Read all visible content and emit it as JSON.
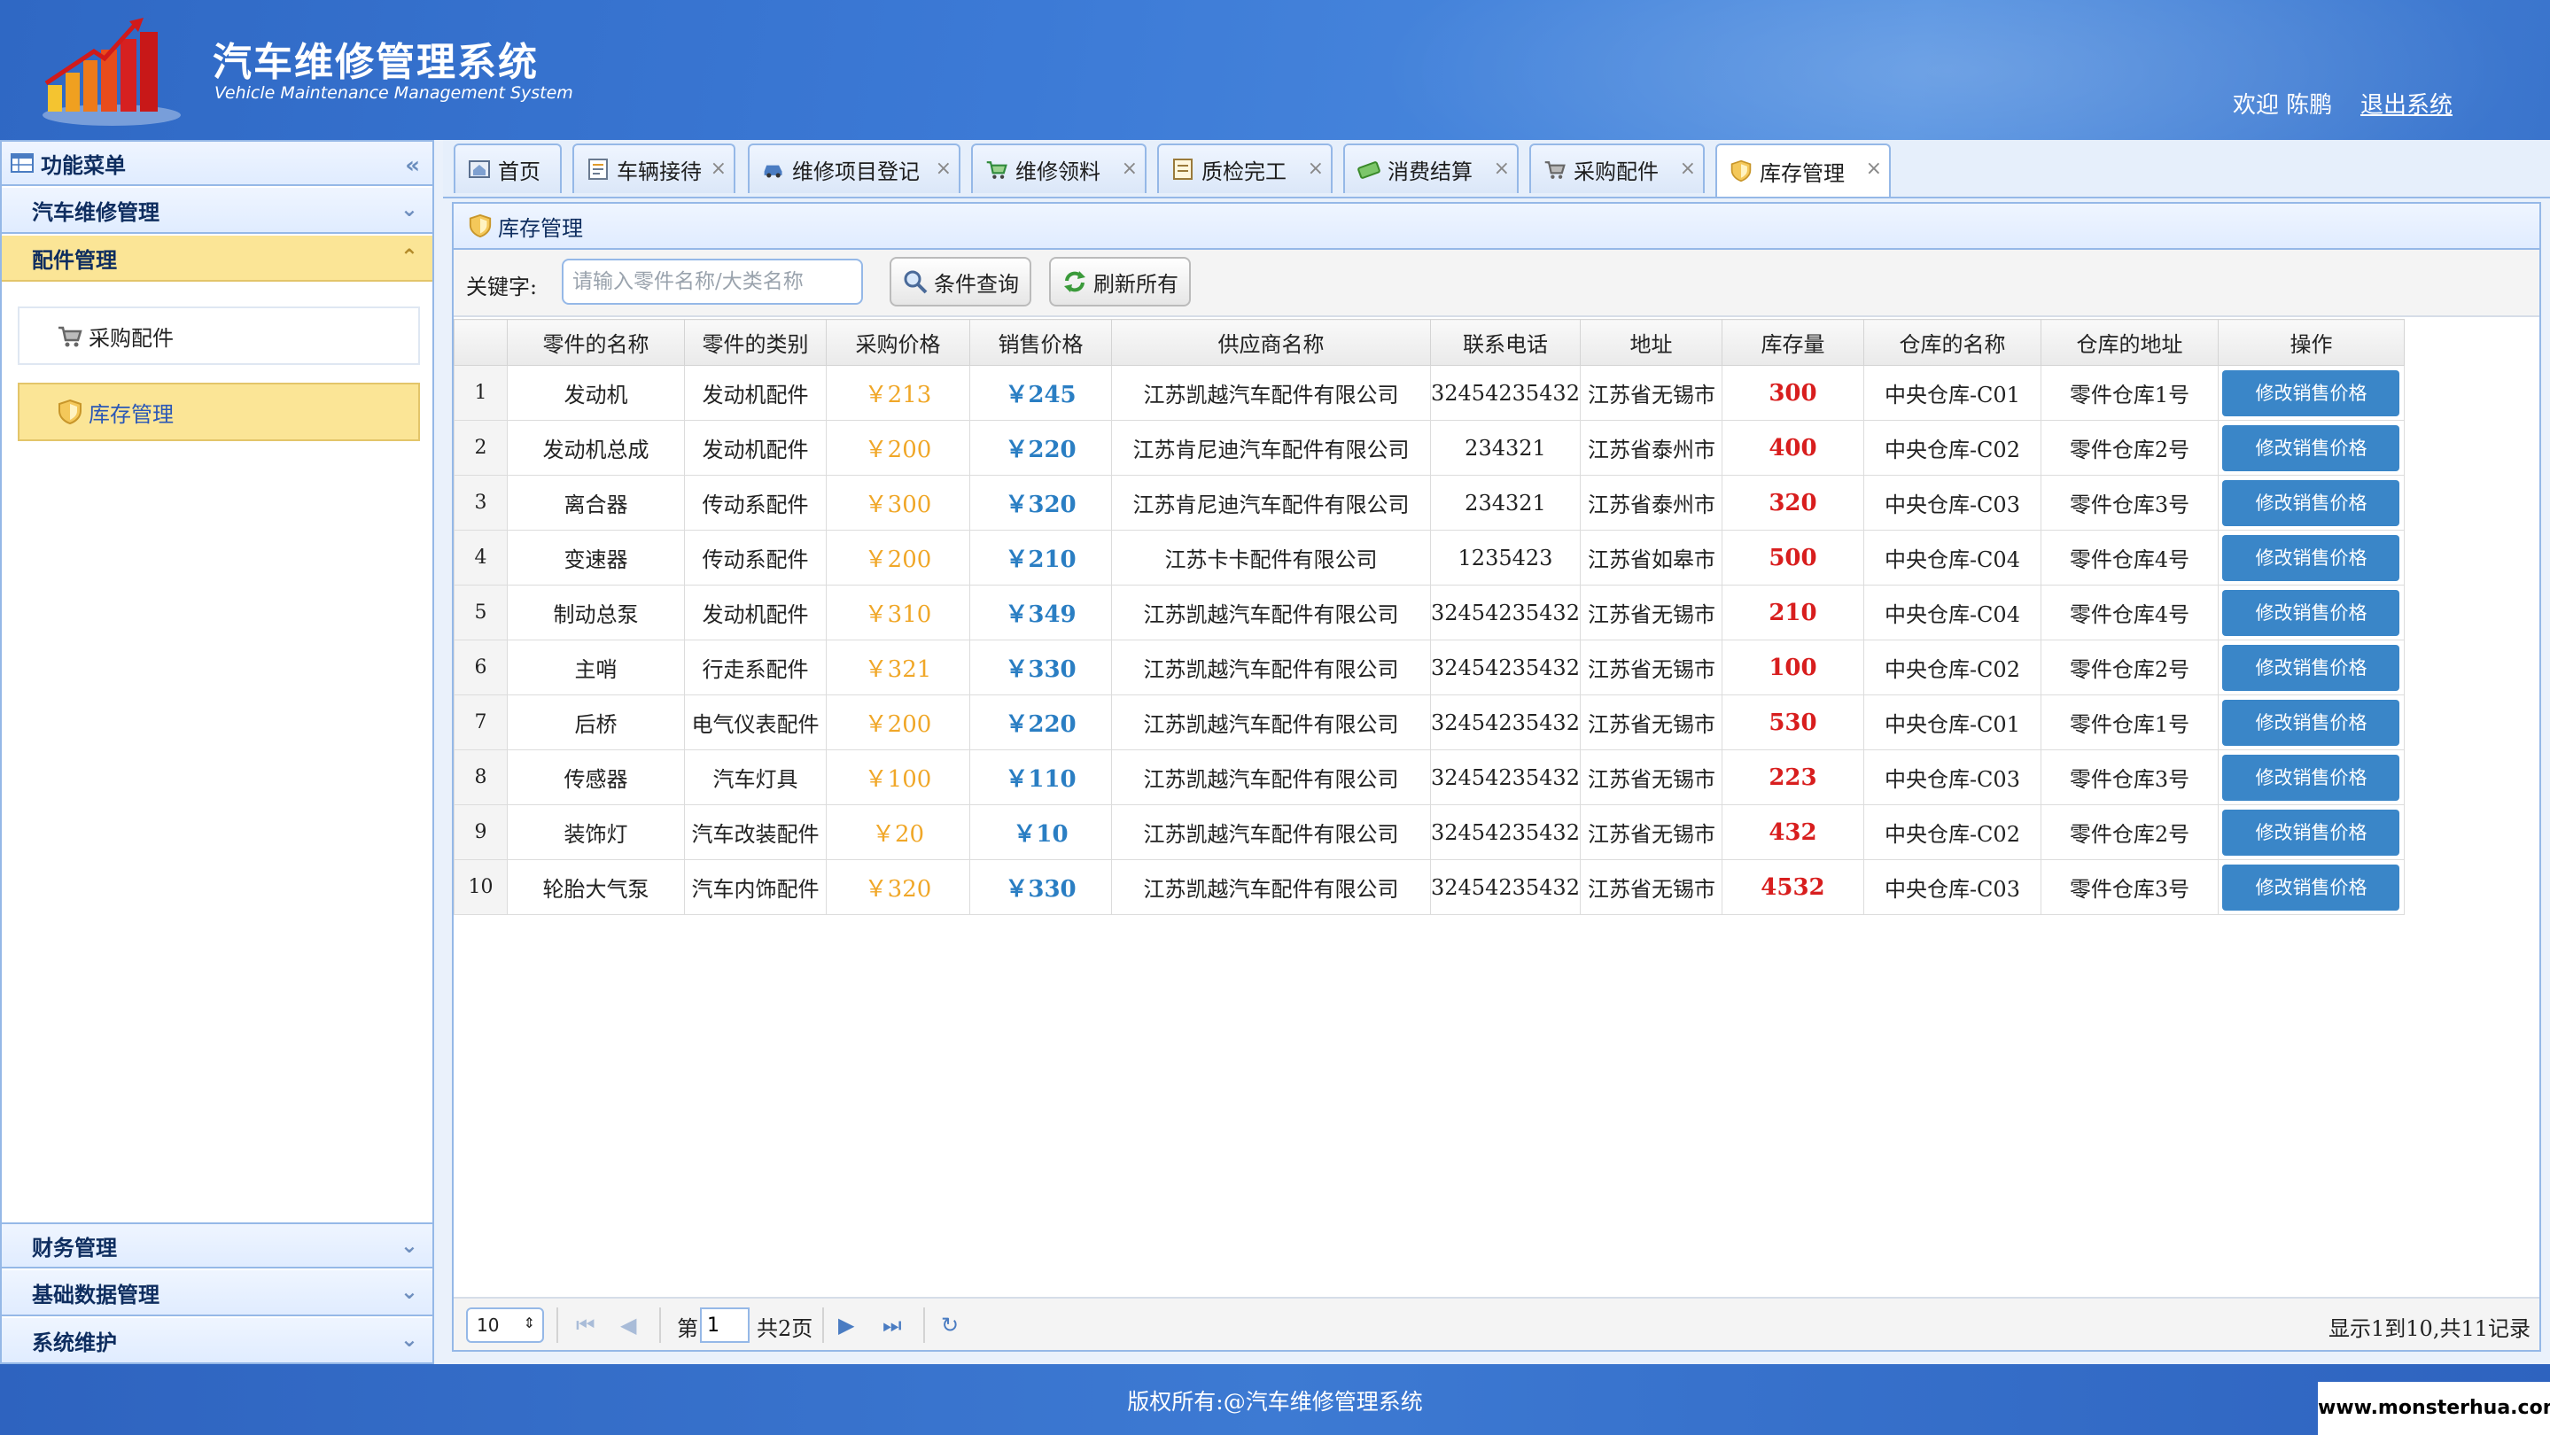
{
  "header": {
    "title": "汽车维修管理系统",
    "subtitle": "Vehicle Maintenance Management System",
    "welcome": "欢迎 陈鹏",
    "logout": "退出系统"
  },
  "sidebar": {
    "title": "功能菜单",
    "groups": [
      {
        "label": "汽车维修管理"
      },
      {
        "label": "配件管理",
        "active": true,
        "items": [
          {
            "label": "采购配件"
          },
          {
            "label": "库存管理",
            "active": true
          }
        ]
      },
      {
        "label": "财务管理"
      },
      {
        "label": "基础数据管理"
      },
      {
        "label": "系统维护"
      }
    ]
  },
  "tabs": [
    {
      "label": "首页",
      "icon": "home-icon"
    },
    {
      "label": "车辆接待",
      "icon": "form-icon"
    },
    {
      "label": "维修项目登记",
      "icon": "car-icon"
    },
    {
      "label": "维修领料",
      "icon": "cart-icon"
    },
    {
      "label": "质检完工",
      "icon": "check-icon"
    },
    {
      "label": "消费结算",
      "icon": "money-icon"
    },
    {
      "label": "采购配件",
      "icon": "cart-icon"
    },
    {
      "label": "库存管理",
      "icon": "shield-icon",
      "active": true
    }
  ],
  "panel": {
    "title": "库存管理"
  },
  "search": {
    "label": "关键字:",
    "value": "",
    "placeholder": "请输入零件名称/大类名称",
    "query_button": "条件查询",
    "refresh_button": "刷新所有"
  },
  "table": {
    "columns": [
      "零件的名称",
      "零件的类别",
      "采购价格",
      "销售价格",
      "供应商名称",
      "联系电话",
      "地址",
      "库存量",
      "仓库的名称",
      "仓库的地址",
      "操作"
    ],
    "action_label": "修改销售价格",
    "rows": [
      {
        "n": "1",
        "name": "发动机",
        "cat": "发动机配件",
        "buy": "￥213",
        "sell": "￥245",
        "supplier": "江苏凯越汽车配件有限公司",
        "phone": "32454235432",
        "addr": "江苏省无锡市",
        "stock": "300",
        "wh": "中央仓库-C01",
        "wh_addr": "零件仓库1号"
      },
      {
        "n": "2",
        "name": "发动机总成",
        "cat": "发动机配件",
        "buy": "￥200",
        "sell": "￥220",
        "supplier": "江苏肯尼迪汽车配件有限公司",
        "phone": "234321",
        "addr": "江苏省泰州市",
        "stock": "400",
        "wh": "中央仓库-C02",
        "wh_addr": "零件仓库2号"
      },
      {
        "n": "3",
        "name": "离合器",
        "cat": "传动系配件",
        "buy": "￥300",
        "sell": "￥320",
        "supplier": "江苏肯尼迪汽车配件有限公司",
        "phone": "234321",
        "addr": "江苏省泰州市",
        "stock": "320",
        "wh": "中央仓库-C03",
        "wh_addr": "零件仓库3号"
      },
      {
        "n": "4",
        "name": "变速器",
        "cat": "传动系配件",
        "buy": "￥200",
        "sell": "￥210",
        "supplier": "江苏卡卡配件有限公司",
        "phone": "1235423",
        "addr": "江苏省如皋市",
        "stock": "500",
        "wh": "中央仓库-C04",
        "wh_addr": "零件仓库4号"
      },
      {
        "n": "5",
        "name": "制动总泵",
        "cat": "发动机配件",
        "buy": "￥310",
        "sell": "￥349",
        "supplier": "江苏凯越汽车配件有限公司",
        "phone": "32454235432",
        "addr": "江苏省无锡市",
        "stock": "210",
        "wh": "中央仓库-C04",
        "wh_addr": "零件仓库4号"
      },
      {
        "n": "6",
        "name": "主哨",
        "cat": "行走系配件",
        "buy": "￥321",
        "sell": "￥330",
        "supplier": "江苏凯越汽车配件有限公司",
        "phone": "32454235432",
        "addr": "江苏省无锡市",
        "stock": "100",
        "wh": "中央仓库-C02",
        "wh_addr": "零件仓库2号"
      },
      {
        "n": "7",
        "name": "后桥",
        "cat": "电气仪表配件",
        "buy": "￥200",
        "sell": "￥220",
        "supplier": "江苏凯越汽车配件有限公司",
        "phone": "32454235432",
        "addr": "江苏省无锡市",
        "stock": "530",
        "wh": "中央仓库-C01",
        "wh_addr": "零件仓库1号"
      },
      {
        "n": "8",
        "name": "传感器",
        "cat": "汽车灯具",
        "buy": "￥100",
        "sell": "￥110",
        "supplier": "江苏凯越汽车配件有限公司",
        "phone": "32454235432",
        "addr": "江苏省无锡市",
        "stock": "223",
        "wh": "中央仓库-C03",
        "wh_addr": "零件仓库3号"
      },
      {
        "n": "9",
        "name": "装饰灯",
        "cat": "汽车改装配件",
        "buy": "￥20",
        "sell": "￥10",
        "supplier": "江苏凯越汽车配件有限公司",
        "phone": "32454235432",
        "addr": "江苏省无锡市",
        "stock": "432",
        "wh": "中央仓库-C02",
        "wh_addr": "零件仓库2号"
      },
      {
        "n": "10",
        "name": "轮胎大气泵",
        "cat": "汽车内饰配件",
        "buy": "￥320",
        "sell": "￥330",
        "supplier": "江苏凯越汽车配件有限公司",
        "phone": "32454235432",
        "addr": "江苏省无锡市",
        "stock": "4532",
        "wh": "中央仓库-C03",
        "wh_addr": "零件仓库3号"
      }
    ]
  },
  "pager": {
    "page_size": "10",
    "page_prefix": "第",
    "page_value": "1",
    "page_suffix": "共2页",
    "info": "显示1到10,共11记录"
  },
  "footer": {
    "copyright": "版权所有:@汽车维修管理系统"
  },
  "watermark": "www.monsterhua.com",
  "colors": {
    "header_blue": "#3c7ad6",
    "border": "#95b8e7",
    "active_yellow": "#fbe596",
    "buy_price": "#f0a728",
    "sell_price": "#2a7ec3",
    "stock": "#d81e1e",
    "action_button": "#3a86c8"
  }
}
